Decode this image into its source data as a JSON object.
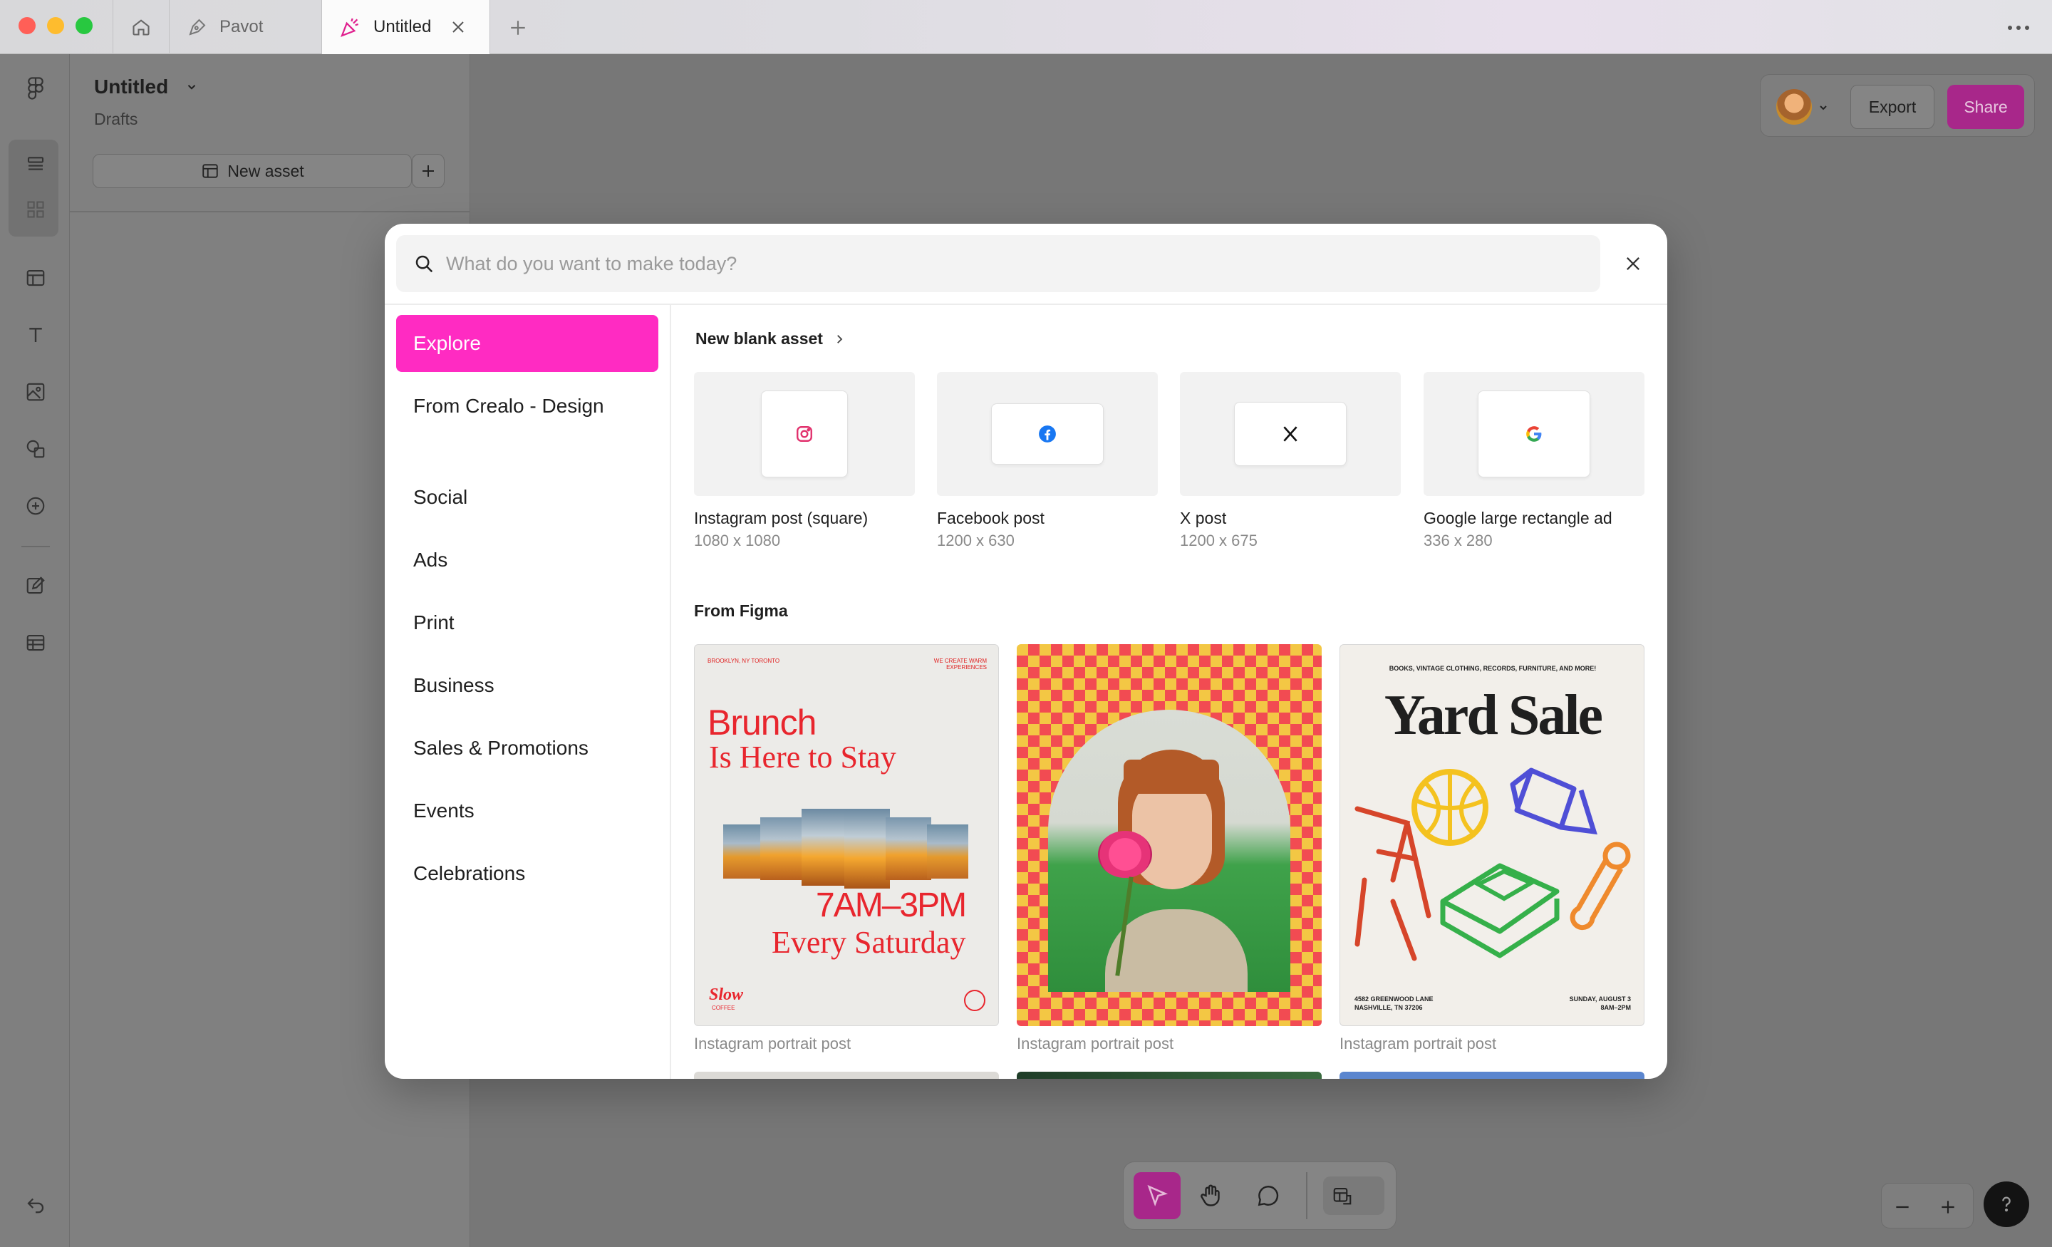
{
  "titlebar": {
    "tabs": [
      {
        "label": "Pavot"
      },
      {
        "label": "Untitled"
      }
    ]
  },
  "sidepanel": {
    "title": "Untitled",
    "subtitle": "Drafts",
    "new_asset_label": "New asset"
  },
  "header": {
    "export_label": "Export",
    "share_label": "Share"
  },
  "modal": {
    "search": {
      "placeholder": "What do you want to make today?"
    },
    "nav": [
      {
        "label": "Explore"
      },
      {
        "label": "From Crealo - Design"
      },
      {
        "label": "Social"
      },
      {
        "label": "Ads"
      },
      {
        "label": "Print"
      },
      {
        "label": "Business"
      },
      {
        "label": "Sales & Promotions"
      },
      {
        "label": "Events"
      },
      {
        "label": "Celebrations"
      }
    ],
    "blank_section_title": "New blank asset",
    "blank_assets": [
      {
        "name": "Instagram post (square)",
        "size": "1080 x 1080",
        "icon": "instagram-icon"
      },
      {
        "name": "Facebook post",
        "size": "1200 x 630",
        "icon": "facebook-icon"
      },
      {
        "name": "X post",
        "size": "1200 x 675",
        "icon": "x-icon"
      },
      {
        "name": "Google large rectangle ad",
        "size": "336 x 280",
        "icon": "google-icon"
      }
    ],
    "figma_section_title": "From Figma",
    "templates": [
      {
        "caption": "Instagram portrait post",
        "headline1": "Brunch",
        "headline2": "Is Here to Stay",
        "small_left": "BROOKLYN, NY  TORONTO",
        "small_right": "WE CREATE WARM EXPERIENCES",
        "time": "7AM–3PM",
        "day": "Every Saturday",
        "brand": "Slow",
        "brand_sub": "COFFEE"
      },
      {
        "caption": "Instagram portrait post"
      },
      {
        "caption": "Instagram portrait post",
        "top_line": "BOOKS, VINTAGE CLOTHING, RECORDS, FURNITURE, AND MORE!",
        "headline": "Yard Sale",
        "address1": "4582 GREENWOOD LANE",
        "address2": "NASHVILLE, TN 37206",
        "date1": "SUNDAY, AUGUST 3",
        "date2": "8AM–2PM"
      }
    ]
  },
  "colors": {
    "accent": "#ff2bc2",
    "share_button": "#a8278a"
  }
}
